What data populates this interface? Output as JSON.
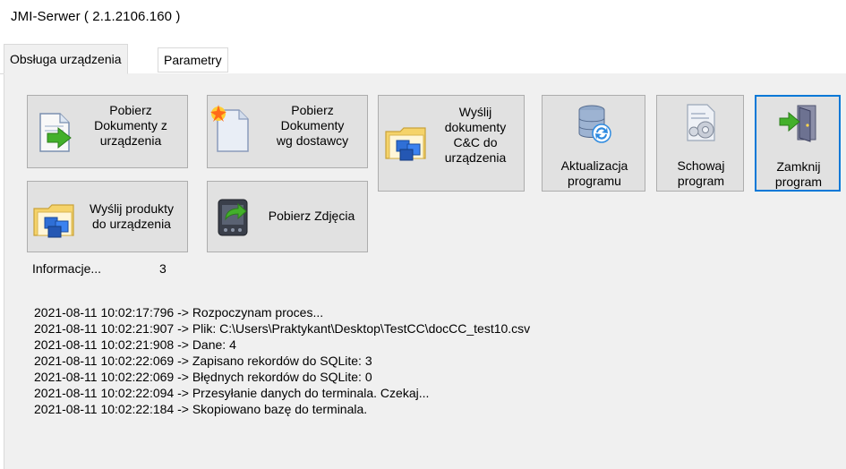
{
  "window": {
    "title": "JMI-Serwer ( 2.1.2106.160 )"
  },
  "tabs": [
    {
      "label": "Obsługa urządzenia",
      "active": true
    },
    {
      "label": "Parametry",
      "active": false
    }
  ],
  "buttons": {
    "pobierz_dokumenty": {
      "label": "Pobierz\nDokumenty z\nurządzenia",
      "icon": "document-arrow-icon"
    },
    "pobierz_dostawcy": {
      "label": "Pobierz\nDokumenty\nwg dostawcy",
      "icon": "document-star-icon"
    },
    "wyslij_cc": {
      "label": "Wyślij\ndokumenty\nC&C do\nurządzenia",
      "icon": "folder-boxes-icon"
    },
    "aktualizacja": {
      "label": "Aktualizacja\nprogramu",
      "icon": "database-sync-icon"
    },
    "schowaj": {
      "label": "Schowaj\nprogram",
      "icon": "document-gear-icon"
    },
    "zamknij": {
      "label": "Zamknij\nprogram",
      "icon": "door-exit-icon"
    },
    "wyslij_produkty": {
      "label": "Wyślij produkty\ndo urządzenia",
      "icon": "folder-boxes-icon"
    },
    "pobierz_zdjecia": {
      "label": "Pobierz Zdjęcia",
      "icon": "device-upload-icon"
    }
  },
  "info": {
    "label": "Informacje...",
    "count": "3"
  },
  "log": [
    "2021-08-11 10:02:17:796 -> Rozpoczynam proces...",
    "2021-08-11 10:02:21:907 -> Plik: C:\\Users\\Praktykant\\Desktop\\TestCC\\docCC_test10.csv",
    "2021-08-11 10:02:21:908 -> Dane: 4",
    "2021-08-11 10:02:22:069 -> Zapisano rekordów do SQLite: 3",
    "2021-08-11 10:02:22:069 -> Błędnych rekordów do SQLite: 0",
    "2021-08-11 10:02:22:094 -> Przesyłanie danych do terminala. Czekaj...",
    "2021-08-11 10:02:22:184 -> Skopiowano bazę do terminala."
  ]
}
